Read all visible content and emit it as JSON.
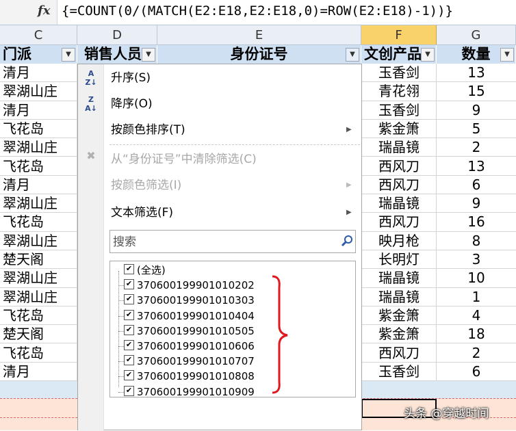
{
  "formula_bar": {
    "fx": "fx",
    "formula": "{=COUNT(0/(MATCH(E2:E18,E2:E18,0)=ROW(E2:E18)-1))}"
  },
  "columns": {
    "C": "C",
    "D": "D",
    "E": "E",
    "F": "F",
    "G": "G"
  },
  "headers": {
    "C": "门派",
    "D": "销售人员",
    "E": "身份证号",
    "F": "文创产品",
    "G": "数量"
  },
  "rows": [
    {
      "C": "清月",
      "F": "玉香剑",
      "G": "13"
    },
    {
      "C": "翠湖山庄",
      "F": "青花翎",
      "G": "15"
    },
    {
      "C": "清月",
      "F": "玉香剑",
      "G": "9"
    },
    {
      "C": "飞花岛",
      "F": "紫金箫",
      "G": "5"
    },
    {
      "C": "翠湖山庄",
      "F": "瑞晶镜",
      "G": "2"
    },
    {
      "C": "飞花岛",
      "F": "西风刀",
      "G": "13"
    },
    {
      "C": "清月",
      "F": "西风刀",
      "G": "6"
    },
    {
      "C": "翠湖山庄",
      "F": "瑞晶镜",
      "G": "9"
    },
    {
      "C": "飞花岛",
      "F": "西风刀",
      "G": "16"
    },
    {
      "C": "翠湖山庄",
      "F": "映月枪",
      "G": "8"
    },
    {
      "C": "楚天阁",
      "F": "长明灯",
      "G": "3"
    },
    {
      "C": "翠湖山庄",
      "F": "瑞晶镜",
      "G": "10"
    },
    {
      "C": "翠湖山庄",
      "F": "瑞晶镜",
      "G": "1"
    },
    {
      "C": "飞花岛",
      "F": "紫金箫",
      "G": "4"
    },
    {
      "C": "楚天阁",
      "F": "紫金箫",
      "G": "18"
    },
    {
      "C": "飞花岛",
      "F": "西风刀",
      "G": "2"
    },
    {
      "C": "清月",
      "F": "玉香剑",
      "G": "6"
    }
  ],
  "filter_menu": {
    "sort_asc": "升序(S)",
    "sort_desc": "降序(O)",
    "sort_by_color": "按颜色排序(T)",
    "clear_filter": "从“身份证号”中清除筛选(C)",
    "filter_by_color": "按颜色筛选(I)",
    "text_filter": "文本筛选(F)",
    "search_placeholder": "搜索",
    "select_all": "(全选)",
    "items": [
      "370600199901010202",
      "370600199901010303",
      "370600199901010404",
      "370600199901010505",
      "370600199901010606",
      "370600199901010707",
      "370600199901010808",
      "370600199901010909"
    ]
  },
  "watermark": "头条 @穿越时间",
  "colors": {
    "header_fill": "#cfe0f3",
    "selected_col": "#f9d26a",
    "band_blue": "#dbe9f5",
    "band_peach": "#fce4d6",
    "bracket": "#e0191e"
  }
}
